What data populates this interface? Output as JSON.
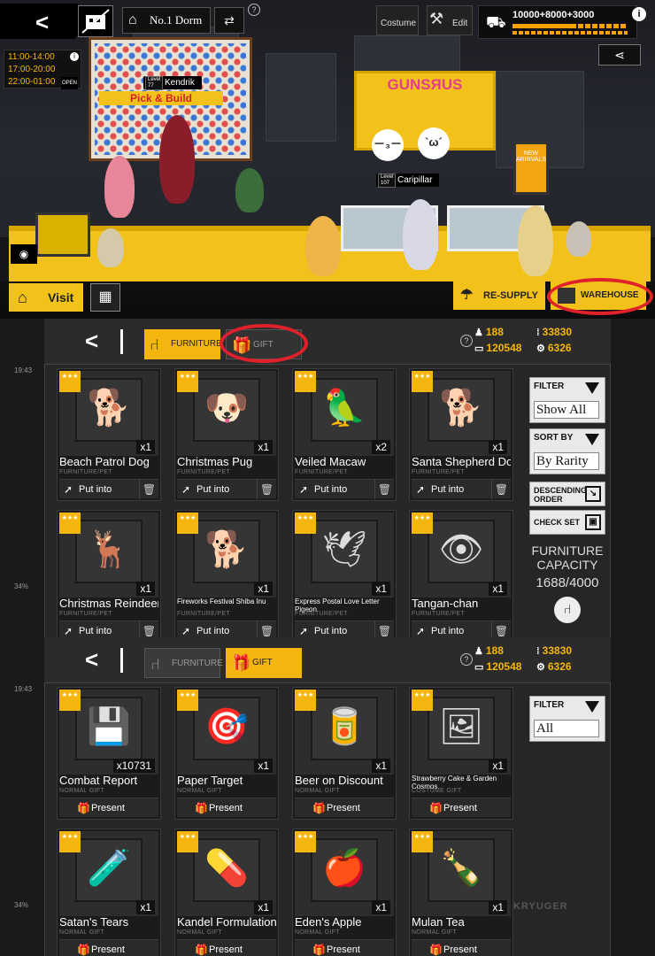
{
  "dorm": {
    "dorm_name": "No.1 Dorm",
    "help": "?",
    "costume_label": "Costume",
    "edit_label": "Edit",
    "resources": "10000+8000+3000",
    "info": "i",
    "hours": [
      "11:00-14:00",
      "17:00-20:00",
      "22:00-01:00"
    ],
    "open_label": "OPEN",
    "shop_sign_left": "Pick & Build",
    "shop_sign_right": "GUNSЯUS",
    "crate_label": "NEW ARRIVALS",
    "char1": {
      "name": "Kendrik",
      "level_label": "Level",
      "level": "77"
    },
    "char2": {
      "name": "Caripillar",
      "level_label": "Level",
      "level": "107"
    },
    "bubble1": "－₃－",
    "bubble2": "`ω´",
    "visit_label": "Visit",
    "resupply_label": "RE-SUPPLY",
    "warehouse_label": "WAREHOUSE"
  },
  "furniture_panel": {
    "time_top": "19:43",
    "time_mid": "34%",
    "tab_furniture": "FURNITURE",
    "tab_gift": "GIFT",
    "help": "?",
    "stats": {
      "a": "188",
      "b": "33830",
      "c": "120548",
      "d": "6326"
    },
    "stars": "★★★",
    "items": [
      {
        "name": "Beach Patrol Dog",
        "cat": "FURNITURE/PET",
        "qty": "x1",
        "action": "Put into",
        "icon": "dog-icon",
        "glyph": "🐕"
      },
      {
        "name": "Christmas Pug",
        "cat": "FURNITURE/PET",
        "qty": "x1",
        "action": "Put into",
        "icon": "pug-icon",
        "glyph": "🐶"
      },
      {
        "name": "Veiled Macaw",
        "cat": "FURNITURE/PET",
        "qty": "x2",
        "action": "Put into",
        "icon": "macaw-icon",
        "glyph": "🦜"
      },
      {
        "name": "Santa Shepherd Dog",
        "cat": "FURNITURE/PET",
        "qty": "x1",
        "action": "Put into",
        "icon": "shepherd-icon",
        "glyph": "🐕"
      },
      {
        "name": "Christmas Reindeer",
        "cat": "FURNITURE/PET",
        "qty": "x1",
        "action": "Put into",
        "icon": "reindeer-icon",
        "glyph": "🦌"
      },
      {
        "name": "Fireworks Festival Shiba Inu",
        "cat": "FURNITURE/PET",
        "qty": "x1",
        "action": "Put into",
        "icon": "shiba-icon",
        "glyph": "🐕"
      },
      {
        "name": "Express Postal Love Letter Pigeon",
        "cat": "FURNITURE/PET",
        "qty": "x1",
        "action": "Put into",
        "icon": "pigeon-icon",
        "glyph": "🕊"
      },
      {
        "name": "Tangan-chan",
        "cat": "FURNITURE/PET",
        "qty": "x1",
        "action": "Put into",
        "icon": "tangan-icon",
        "glyph": "👁"
      }
    ],
    "filter_label": "FILTER",
    "filter_value": "Show All",
    "sort_label": "SORT BY",
    "sort_value": "By Rarity",
    "order_label": "DESCENDING ORDER",
    "check_set_label": "CHECK SET",
    "capacity_label": "FURNITURE CAPACITY",
    "capacity_value": "1688/4000"
  },
  "gift_panel": {
    "time_top": "19:43",
    "time_mid": "34%",
    "tab_furniture": "FURNITURE",
    "tab_gift": "GIFT",
    "help": "?",
    "stats": {
      "a": "188",
      "b": "33830",
      "c": "120548",
      "d": "6326"
    },
    "stars": "★★★",
    "items": [
      {
        "name": "Combat Report",
        "cat": "NORMAL GIFT",
        "qty": "x10731",
        "action": "Present",
        "icon": "floppy-disk-icon",
        "glyph": "💾"
      },
      {
        "name": "Paper Target",
        "cat": "NORMAL GIFT",
        "qty": "x1",
        "action": "Present",
        "icon": "paper-target-icon",
        "glyph": "🎯"
      },
      {
        "name": "Beer on Discount",
        "cat": "NORMAL GIFT",
        "qty": "x1",
        "action": "Present",
        "icon": "beer-can-icon",
        "glyph": "🥫"
      },
      {
        "name": "Strawberry Cake & Garden Cosmos",
        "cat": "COSTUME GIFT",
        "qty": "x1",
        "action": "Present",
        "icon": "card-icon",
        "glyph": "🖼"
      },
      {
        "name": "Satan's Tears",
        "cat": "NORMAL GIFT",
        "qty": "x1",
        "action": "Present",
        "icon": "bottle-icon",
        "glyph": "🧪"
      },
      {
        "name": "Kandel Formulation",
        "cat": "NORMAL GIFT",
        "qty": "x1",
        "action": "Present",
        "icon": "capsule-icon",
        "glyph": "💊"
      },
      {
        "name": "Eden's Apple",
        "cat": "NORMAL GIFT",
        "qty": "x1",
        "action": "Present",
        "icon": "apple-icon",
        "glyph": "🍎"
      },
      {
        "name": "Mulan Tea",
        "cat": "NORMAL GIFT",
        "qty": "x1",
        "action": "Present",
        "icon": "tea-bottle-icon",
        "glyph": "🍾"
      }
    ],
    "filter_label": "FILTER",
    "filter_value": "All",
    "watermark": "KRYUGER"
  }
}
